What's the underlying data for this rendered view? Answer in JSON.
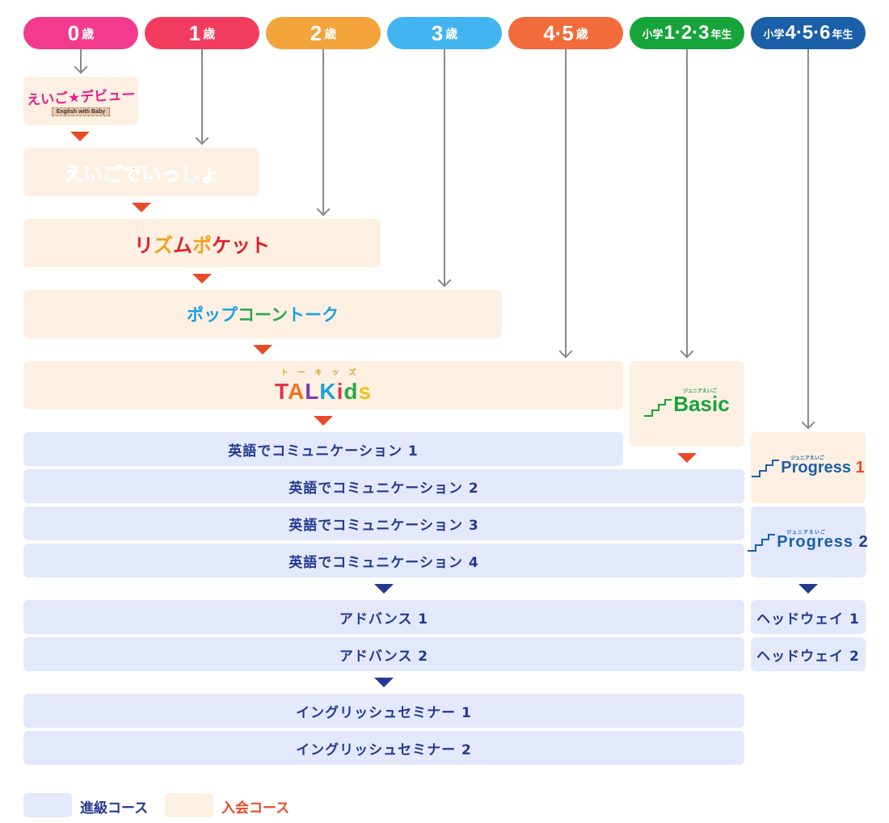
{
  "age_headers": [
    {
      "id": "age-0",
      "num": "0",
      "unit": "歳",
      "color": "#f23b8e"
    },
    {
      "id": "age-1",
      "num": "1",
      "unit": "歳",
      "color": "#f23c5e"
    },
    {
      "id": "age-2",
      "num": "2",
      "unit": "歳",
      "color": "#f2a33a"
    },
    {
      "id": "age-3",
      "num": "3",
      "unit": "歳",
      "color": "#42b4f0"
    },
    {
      "id": "age-4-5",
      "num": "4·5",
      "unit": "歳",
      "color": "#f26b3a"
    },
    {
      "id": "grade-1-3",
      "prefix": "小学",
      "num": "1·2·3",
      "unit": "年生",
      "color": "#16a43a"
    },
    {
      "id": "grade-4-6",
      "prefix": "小学",
      "num": "4·5·6",
      "unit": "年生",
      "color": "#1a5fa8"
    }
  ],
  "entry_courses": {
    "eigo_debut": {
      "title": "えいご★デビュー",
      "subtitle": "English with Baby"
    },
    "eigo_issho": {
      "chars": [
        "え",
        "い",
        "ご",
        "で",
        "い",
        "っ",
        "し",
        "ょ"
      ],
      "colors": [
        "#7a3fb0",
        "#e2334a",
        "#2aa84a",
        "#e2334a",
        "#1e90e0",
        "#e2334a",
        "#2a5fc8",
        "#f0a020"
      ]
    },
    "rhythm_pocket": {
      "chars": [
        "リ",
        "ズ",
        "ム",
        "ポ",
        "ケ",
        "ッ",
        "ト"
      ],
      "colors": [
        "#e0202a",
        "#f0a020",
        "#e0202a",
        "#f0a020",
        "#e0202a",
        "#e0202a",
        "#e0202a"
      ]
    },
    "popcorn_talk": {
      "chars": [
        "ポ",
        "ッ",
        "プ",
        "コ",
        "ー",
        "ン",
        "ト",
        "ー",
        "ク"
      ],
      "colors": [
        "#1aa0e0",
        "#1aa0e0",
        "#1aa0e0",
        "#2aa84a",
        "#2aa84a",
        "#2aa84a",
        "#1aa0e0",
        "#1aa0e0",
        "#1aa0e0"
      ]
    },
    "talkids": {
      "ruby": "トーキッズ",
      "letters": [
        "T",
        "A",
        "L",
        "K",
        "i",
        "d",
        "s"
      ],
      "colors": [
        "#e2334a",
        "#f07020",
        "#7a3fb0",
        "#1aa0e0",
        "#e2334a",
        "#2aa84a",
        "#f0c020"
      ]
    },
    "junior_basic": {
      "ruby": "ジュニアえいご",
      "word": "Basic",
      "color": "#16a43a"
    },
    "junior_progress_1": {
      "ruby": "ジュニアえいご",
      "word": "Progress",
      "num": "1",
      "color": "#1a5fa8",
      "num_color": "#e84a27"
    }
  },
  "advance_courses": {
    "communication": [
      "英語でコミュニケーション 1",
      "英語でコミュニケーション 2",
      "英語でコミュニケーション 3",
      "英語でコミュニケーション 4"
    ],
    "advance": [
      "アドバンス 1",
      "アドバンス 2"
    ],
    "seminar": [
      "イングリッシュセミナー 1",
      "イングリッシュセミナー 2"
    ],
    "junior_progress_2": {
      "ruby": "ジュニアえいご",
      "word": "Progress",
      "num": "2",
      "color": "#1a5fa8",
      "num_color": "#24398e"
    },
    "headway": [
      "ヘッドウェイ 1",
      "ヘッドウェイ 2"
    ]
  },
  "legend": {
    "advance": {
      "label": "進級コース",
      "swatch": "#e3e8fb",
      "text_color": "#24398e"
    },
    "entry": {
      "label": "入会コース",
      "swatch": "#fdf0e2",
      "text_color": "#e84a27"
    }
  }
}
